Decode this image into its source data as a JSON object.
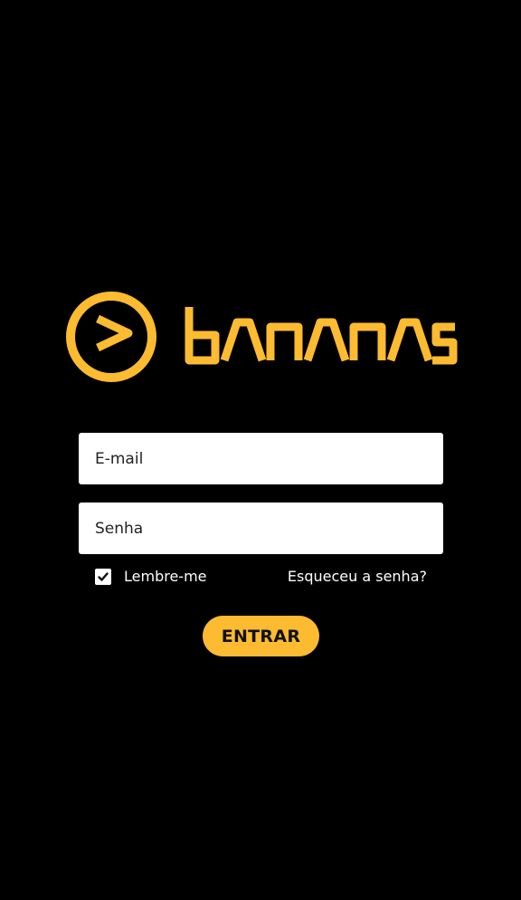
{
  "brand": {
    "name": "bananas",
    "accent_color": "#FCBB30"
  },
  "login": {
    "email_placeholder": "E-mail",
    "password_placeholder": "Senha",
    "remember_label": "Lembre-me",
    "remember_checked": true,
    "forgot_label": "Esqueceu a senha?",
    "submit_label": "ENTRAR"
  },
  "icons": {
    "logo_mark": "play-chevron-circle-icon",
    "checkbox_check": "check-icon"
  }
}
